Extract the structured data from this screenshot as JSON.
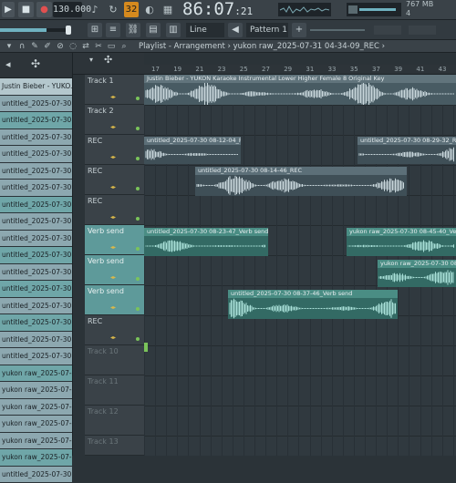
{
  "transport": {
    "tempo": "130.000",
    "time_main": "86:07",
    "time_sub": ":21",
    "mem_line1": "767 MB",
    "mem_line2": "4"
  },
  "toolbar": {
    "line_mode": "Line",
    "pattern": "Pattern 1"
  },
  "playlist": {
    "breadcrumb": "Playlist - Arrangement  ›  yukon raw_2025-07-31 04-34-09_REC  ›"
  },
  "ruler": [
    "17",
    "19",
    "21",
    "23",
    "25",
    "27",
    "29",
    "31",
    "33",
    "35",
    "37",
    "39",
    "41",
    "43",
    "45"
  ],
  "browser_items": [
    "Justin Bieber - YUKO...",
    "untitled_2025-07-30 08-",
    "untitled_2025-07-30 08-",
    "untitled_2025-07-30 08-",
    "untitled_2025-07-30 08-",
    "untitled_2025-07-30 08-",
    "untitled_2025-07-30 08-",
    "untitled_2025-07-30 08-",
    "untitled_2025-07-30 08-",
    "untitled_2025-07-30 08-",
    "untitled_2025-07-30 08-",
    "untitled_2025-07-30 08-",
    "untitled_2025-07-30 08-",
    "untitled_2025-07-30 08-",
    "untitled_2025-07-30 08-",
    "untitled_2025-07-30 08-",
    "untitled_2025-07-30 08-",
    "yukon raw_2025-07-30",
    "yukon raw_2025-07-30",
    "yukon raw_2025-07-30",
    "yukon raw_2025-07-30",
    "yukon raw_2025-07-30",
    "yukon raw_2025-07-30",
    "untitled_2025-07-30"
  ],
  "tracks": [
    {
      "name": "Track 1"
    },
    {
      "name": "Track 2"
    },
    {
      "name": "REC"
    },
    {
      "name": "REC"
    },
    {
      "name": "REC"
    },
    {
      "name": "Verb send"
    },
    {
      "name": "Verb send"
    },
    {
      "name": "Verb send"
    },
    {
      "name": "REC"
    },
    {
      "name": "Track 10"
    },
    {
      "name": "Track 11"
    },
    {
      "name": "Track 12"
    },
    {
      "name": "Track 13"
    }
  ],
  "clips": {
    "c1": "Justin Bieber - YUKON Karaoke Instrumental Lower Higher Female 8 Original Key",
    "c2": "untitled_2025-07-30 08-12-04_REC",
    "c3": "untitled_2025-07-30 08-29-32_REC",
    "c4": "untitled_2025-07-30 08-14-46_REC",
    "c5": "untitled_2025-07-30 08-23-47_Verb send",
    "c6": "yukon raw_2025-07-30 08-45-40_Verb send",
    "c7": "untitled_2025-07-30 08-37-46_Verb send",
    "c8": "yukon raw_2025-07-30 08-38-10_Verb send"
  }
}
